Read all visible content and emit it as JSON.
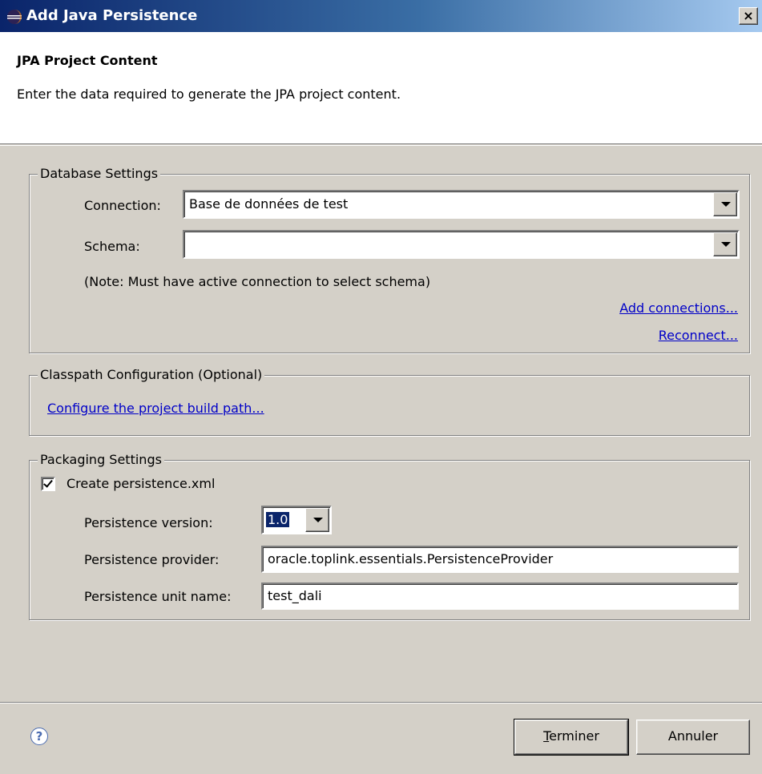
{
  "window": {
    "title": "Add Java Persistence",
    "close_label": "×",
    "icon": "eclipse-icon"
  },
  "header": {
    "title": "JPA Project Content",
    "description": "Enter the data required to generate the JPA project content."
  },
  "database_settings": {
    "legend": "Database Settings",
    "connection_label": "Connection:",
    "connection_value": "Base de données de test",
    "schema_label": "Schema:",
    "schema_value": "",
    "note": "(Note:  Must have active connection to select schema)",
    "add_connections_link": "Add connections...",
    "reconnect_link": "Reconnect..."
  },
  "classpath": {
    "legend": "Classpath Configuration (Optional)",
    "configure_link": "Configure the project build path..."
  },
  "packaging": {
    "legend": "Packaging Settings",
    "create_xml_label": "Create persistence.xml",
    "create_xml_checked": true,
    "version_label": "Persistence version:",
    "version_value": "1.0",
    "provider_label": "Persistence provider:",
    "provider_value": "oracle.toplink.essentials.PersistenceProvider",
    "unit_name_label": "Persistence unit name:",
    "unit_name_value": "test_dali"
  },
  "footer": {
    "help_icon": "help-icon",
    "help_glyph": "?",
    "finish_prefix": "T",
    "finish_rest": "erminer",
    "cancel_label": "Annuler"
  }
}
